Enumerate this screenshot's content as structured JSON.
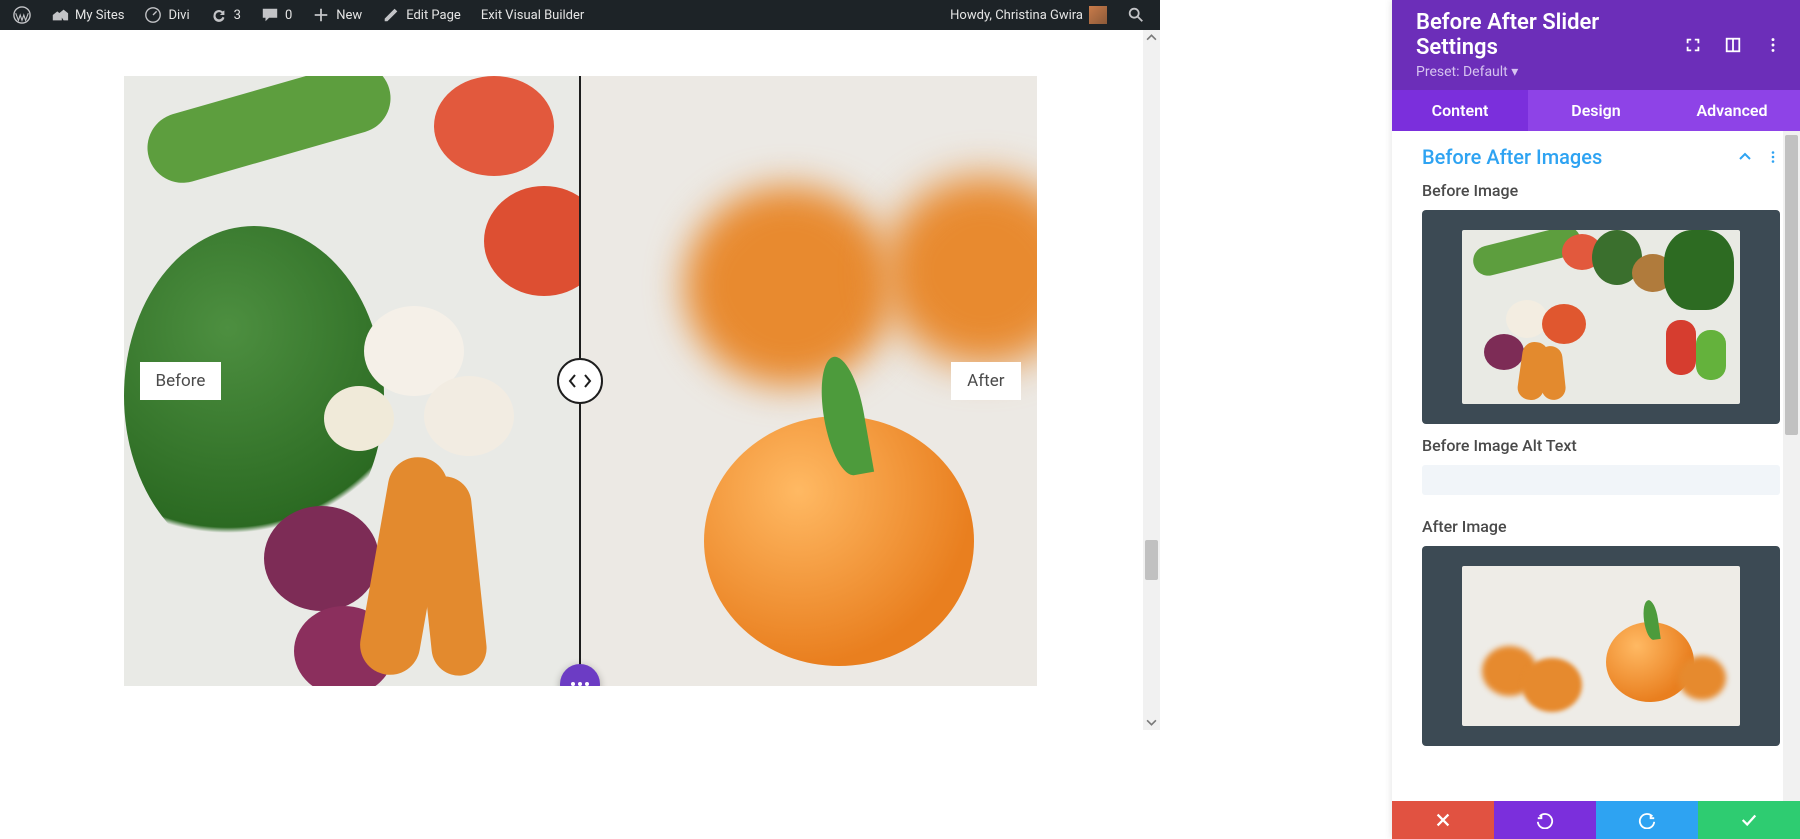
{
  "adminbar": {
    "mysites": "My Sites",
    "site_name": "Divi",
    "updates": "3",
    "comments": "0",
    "new": "New",
    "edit_page": "Edit Page",
    "exit_vb": "Exit Visual Builder",
    "howdy": "Howdy, Christina Gwira"
  },
  "slider": {
    "before_label": "Before",
    "after_label": "After"
  },
  "settings": {
    "title": "Before After Slider Settings",
    "preset": "Preset: Default",
    "tabs": {
      "content": "Content",
      "design": "Design",
      "advanced": "Advanced"
    },
    "section_title": "Before After Images",
    "before_image_label": "Before Image",
    "before_alt_label": "Before Image Alt Text",
    "before_alt_value": "",
    "after_image_label": "After Image"
  }
}
